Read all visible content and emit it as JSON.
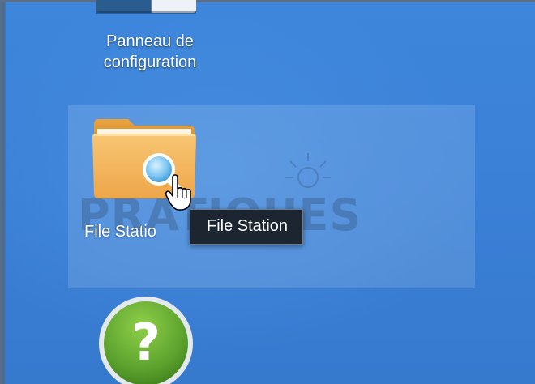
{
  "desktop": {
    "icons": [
      {
        "id": "control-panel",
        "label": "Panneau de configuration",
        "label_lines": [
          "Panneau de",
          "configuration"
        ],
        "icon": "control-panel-icon"
      },
      {
        "id": "file-station",
        "label": "File Station",
        "label_visible": "File Statio",
        "icon": "folder-search-icon",
        "state": "hovered"
      },
      {
        "id": "help",
        "icon": "help-icon",
        "glyph": "?"
      }
    ],
    "tooltip": {
      "text": "File Station"
    },
    "watermark": {
      "text": "PRATIQUES"
    }
  },
  "colors": {
    "background": "#3a7fd5",
    "folder": "#f3b45a",
    "help_green": "#5aa02c",
    "tooltip_bg": "#1d2531"
  }
}
